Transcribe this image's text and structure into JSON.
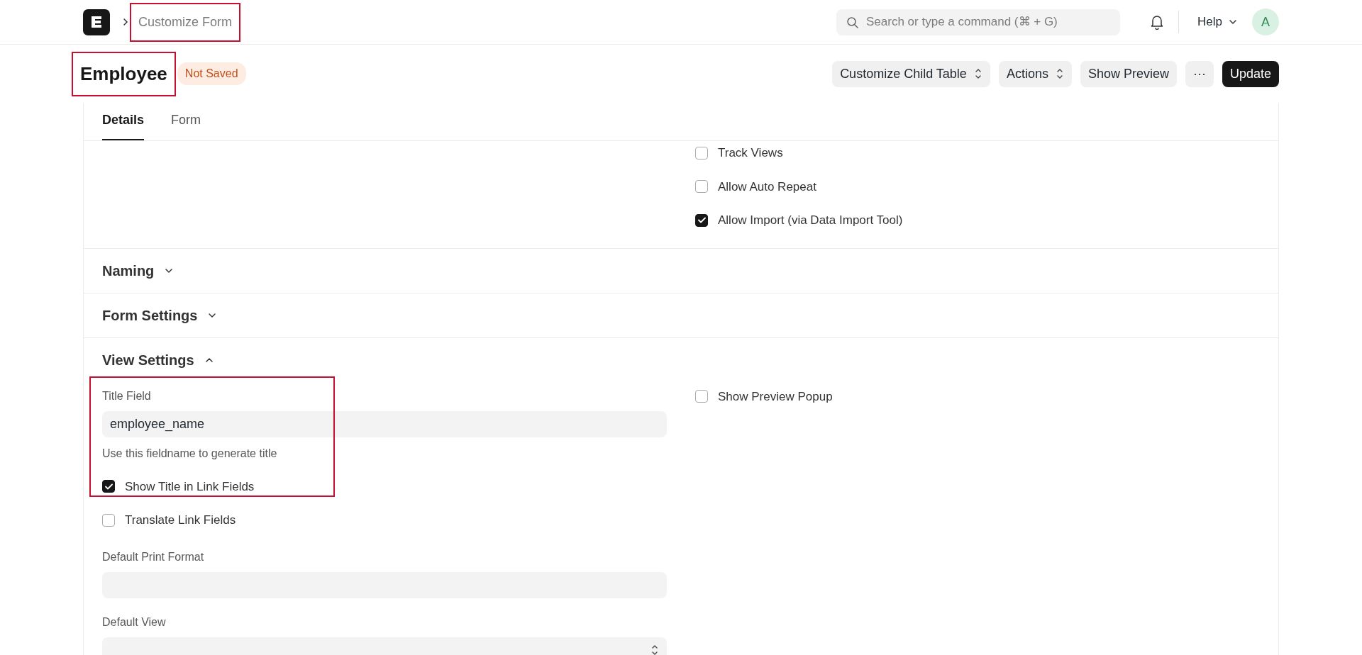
{
  "navbar": {
    "breadcrumb": {
      "label": "Customize Form",
      "highlighted": true
    },
    "search": {
      "placeholder": "Search or type a command (⌘ + G)"
    },
    "help": "Help",
    "avatar": "A"
  },
  "page_header": {
    "title": "Employee",
    "highlighted": true,
    "indicator": "Not Saved",
    "buttons": [
      {
        "label": "Customize Child Table",
        "kind": "select"
      },
      {
        "label": "Actions",
        "kind": "select"
      },
      {
        "label": "Show Preview",
        "kind": "plain"
      },
      {
        "label": "···",
        "kind": "plain"
      },
      {
        "label": "Update",
        "kind": "primary"
      }
    ]
  },
  "tabs": [
    {
      "label": "Details",
      "selected": true
    },
    {
      "label": "Form",
      "selected": false
    }
  ],
  "top_section": {
    "right": [
      {
        "kind": "check",
        "label": "Track Views",
        "checked": false
      },
      {
        "kind": "check",
        "label": "Allow Auto Repeat",
        "checked": false
      },
      {
        "kind": "check",
        "label": "Allow Import (via Data Import Tool)",
        "checked": true
      }
    ]
  },
  "sections": [
    {
      "title": "Naming",
      "expanded": false
    },
    {
      "title": "Form Settings",
      "expanded": false
    },
    {
      "title": "View Settings",
      "expanded": true,
      "left": [
        {
          "kind": "data",
          "label": "Title Field",
          "value": "employee_name",
          "description": "Use this fieldname to generate title",
          "highlighted": true
        },
        {
          "kind": "check",
          "label": "Show Title in Link Fields",
          "checked": true,
          "highlighted": true
        },
        {
          "kind": "check",
          "label": "Translate Link Fields",
          "checked": false,
          "highlighted": false
        },
        {
          "kind": "link",
          "label": "Default Print Format",
          "highlighted": false
        },
        {
          "kind": "select",
          "label": "Default View",
          "highlighted": false
        }
      ],
      "right": [
        {
          "kind": "check",
          "label": "Show Preview Popup",
          "checked": false
        }
      ]
    }
  ]
}
